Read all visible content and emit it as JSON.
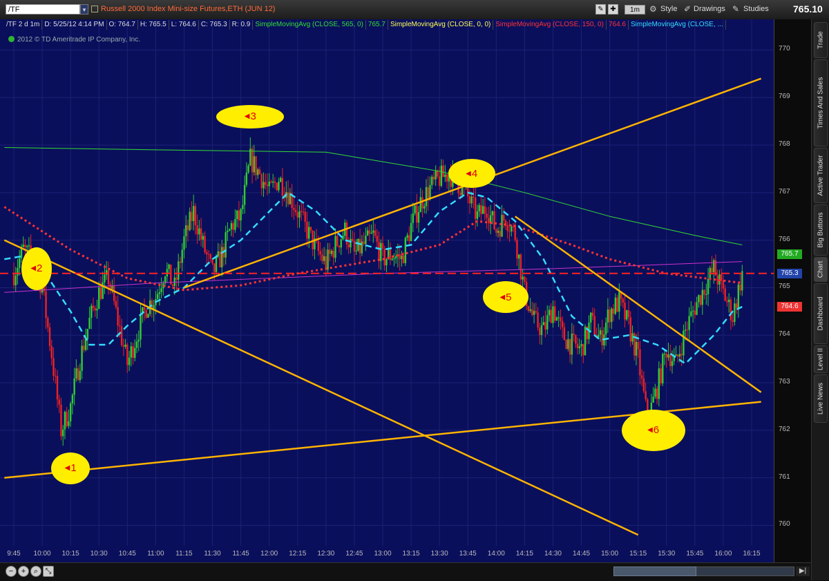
{
  "toolbar": {
    "symbol": "/TF",
    "instrument_title": "Russell 2000 Index Mini-size Futures,ETH (JUN 12)",
    "period": "1m",
    "style_label": "Style",
    "drawings_label": "Drawings",
    "studies_label": "Studies",
    "last_price": "765.10"
  },
  "study_bar": {
    "symbol_period": "/TF 2 d 1m",
    "datetime": "D: 5/25/12 4:14 PM",
    "open": "O: 764.7",
    "high": "H: 765.5",
    "low": "L: 764.6",
    "close": "C: 765.3",
    "range": "R: 0.9",
    "studies": [
      {
        "label": "SimpleMovingAvg (CLOSE, 565, 0)",
        "value": "765.7",
        "color": "#33dd33"
      },
      {
        "label": "SimpleMovingAvg (CLOSE, 0, 0)",
        "value": "",
        "color": "#ffff55"
      },
      {
        "label": "SimpleMovingAvg (CLOSE, 150, 0)",
        "value": "764.6",
        "color": "#ff3333"
      },
      {
        "label": "SimpleMovingAvg (CLOSE, ...",
        "value": "",
        "color": "#33ddff"
      }
    ]
  },
  "copyright": "2012 © TD Ameritrade IP Company, Inc.",
  "price_axis": {
    "ticks": [
      "770",
      "769",
      "768",
      "767",
      "766",
      "765",
      "764",
      "763",
      "762",
      "761",
      "760"
    ],
    "flags": [
      {
        "value": "765.7",
        "bg": "#22aa22",
        "fg": "#ffffff",
        "price": 765.7
      },
      {
        "value": "765.3",
        "bg": "#2244aa",
        "fg": "#ffffff",
        "price": 765.3
      },
      {
        "value": "764.6",
        "bg": "#ee3333",
        "fg": "#ffffff",
        "price": 764.6
      }
    ]
  },
  "time_axis": {
    "ticks": [
      "9:45",
      "10:00",
      "10:15",
      "10:30",
      "10:45",
      "11:00",
      "11:15",
      "11:30",
      "11:45",
      "12:00",
      "12:15",
      "12:30",
      "12:45",
      "13:00",
      "13:15",
      "13:30",
      "13:45",
      "14:00",
      "14:15",
      "14:30",
      "14:45",
      "15:00",
      "15:15",
      "15:30",
      "15:45",
      "16:00",
      "16:15"
    ]
  },
  "side_tabs": [
    "Trade",
    "Times And Sales",
    "Active Trader",
    "Big Buttons",
    "Chart",
    "Dashboard",
    "Level II",
    "Live News"
  ],
  "callouts": [
    "1",
    "2",
    "3",
    "4",
    "5",
    "6"
  ],
  "colors": {
    "background": "#0a0f5c",
    "bull_candle": "#33cc33",
    "bear_candle": "#ee2222",
    "trendline": "#ffb400",
    "sma565": "#33dd33",
    "sma150": "#ff3333",
    "sma_fast": "#33ddff",
    "sma_flat": "#cc33cc",
    "callout": "#ffee00"
  },
  "chart_data": {
    "type": "candlestick",
    "y_range": [
      759.6,
      770.5
    ],
    "x_range": [
      "9:40",
      "16:20"
    ],
    "price_path": [
      [
        "9:45",
        765.3
      ],
      [
        "9:50",
        765.8
      ],
      [
        "9:55",
        765.6
      ],
      [
        "10:00",
        765.0
      ],
      [
        "10:05",
        763.6
      ],
      [
        "10:10",
        762.0
      ],
      [
        "10:15",
        762.5
      ],
      [
        "10:20",
        763.5
      ],
      [
        "10:25",
        764.3
      ],
      [
        "10:30",
        764.9
      ],
      [
        "10:35",
        765.2
      ],
      [
        "10:40",
        764.3
      ],
      [
        "10:45",
        763.4
      ],
      [
        "10:50",
        764.0
      ],
      [
        "10:55",
        764.6
      ],
      [
        "11:00",
        764.8
      ],
      [
        "11:05",
        765.4
      ],
      [
        "11:10",
        765.0
      ],
      [
        "11:15",
        766.0
      ],
      [
        "11:20",
        766.6
      ],
      [
        "11:25",
        765.9
      ],
      [
        "11:30",
        765.3
      ],
      [
        "11:35",
        765.7
      ],
      [
        "11:40",
        766.3
      ],
      [
        "11:45",
        766.5
      ],
      [
        "11:50",
        767.7
      ],
      [
        "11:55",
        767.4
      ],
      [
        "12:00",
        767.0
      ],
      [
        "12:05",
        767.3
      ],
      [
        "12:10",
        767.0
      ],
      [
        "12:15",
        766.6
      ],
      [
        "12:20",
        766.2
      ],
      [
        "12:25",
        765.8
      ],
      [
        "12:30",
        765.5
      ],
      [
        "12:35",
        765.9
      ],
      [
        "12:40",
        766.2
      ],
      [
        "12:45",
        765.7
      ],
      [
        "12:50",
        765.9
      ],
      [
        "12:55",
        766.1
      ],
      [
        "13:00",
        765.6
      ],
      [
        "13:05",
        765.7
      ],
      [
        "13:10",
        765.6
      ],
      [
        "13:15",
        766.3
      ],
      [
        "13:20",
        766.8
      ],
      [
        "13:25",
        767.1
      ],
      [
        "13:30",
        767.3
      ],
      [
        "13:35",
        767.4
      ],
      [
        "13:40",
        767.2
      ],
      [
        "13:45",
        766.9
      ],
      [
        "13:50",
        766.5
      ],
      [
        "13:55",
        766.7
      ],
      [
        "14:00",
        766.2
      ],
      [
        "14:05",
        766.5
      ],
      [
        "14:10",
        766.1
      ],
      [
        "14:15",
        764.9
      ],
      [
        "14:20",
        764.3
      ],
      [
        "14:25",
        764.1
      ],
      [
        "14:30",
        764.6
      ],
      [
        "14:35",
        764.0
      ],
      [
        "14:40",
        763.8
      ],
      [
        "14:45",
        763.7
      ],
      [
        "14:50",
        764.3
      ],
      [
        "14:55",
        763.9
      ],
      [
        "15:00",
        764.5
      ],
      [
        "15:05",
        764.7
      ],
      [
        "15:10",
        764.2
      ],
      [
        "15:15",
        763.5
      ],
      [
        "15:20",
        762.2
      ],
      [
        "15:25",
        762.9
      ],
      [
        "15:30",
        763.7
      ],
      [
        "15:35",
        763.4
      ],
      [
        "15:40",
        764.1
      ],
      [
        "15:45",
        764.6
      ],
      [
        "15:50",
        765.0
      ],
      [
        "15:55",
        765.4
      ],
      [
        "16:00",
        764.9
      ],
      [
        "16:05",
        764.4
      ],
      [
        "16:10",
        765.3
      ]
    ],
    "sma565": [
      [
        "9:40",
        767.95
      ],
      [
        "11:00",
        767.9
      ],
      [
        "12:30",
        767.85
      ],
      [
        "13:30",
        767.45
      ],
      [
        "14:15",
        767.0
      ],
      [
        "15:00",
        766.5
      ],
      [
        "15:45",
        766.1
      ],
      [
        "16:10",
        765.9
      ]
    ],
    "sma150": [
      [
        "9:40",
        766.7
      ],
      [
        "10:15",
        765.8
      ],
      [
        "10:45",
        765.2
      ],
      [
        "11:15",
        764.95
      ],
      [
        "11:45",
        765.05
      ],
      [
        "12:15",
        765.3
      ],
      [
        "13:00",
        765.6
      ],
      [
        "13:30",
        765.9
      ],
      [
        "13:50",
        766.4
      ],
      [
        "14:10",
        766.3
      ],
      [
        "14:40",
        765.9
      ],
      [
        "15:00",
        765.6
      ],
      [
        "15:30",
        765.3
      ],
      [
        "16:10",
        765.1
      ]
    ],
    "sma_flat": [
      [
        "9:40",
        764.9
      ],
      [
        "11:00",
        765.1
      ],
      [
        "13:00",
        765.3
      ],
      [
        "14:30",
        765.4
      ],
      [
        "16:10",
        765.55
      ]
    ],
    "sma_fast": [
      [
        "9:40",
        765.6
      ],
      [
        "9:55",
        765.7
      ],
      [
        "10:05",
        765.1
      ],
      [
        "10:15",
        764.5
      ],
      [
        "10:25",
        763.8
      ],
      [
        "10:35",
        763.8
      ],
      [
        "10:45",
        764.2
      ],
      [
        "11:00",
        764.7
      ],
      [
        "11:15",
        765.0
      ],
      [
        "11:30",
        765.6
      ],
      [
        "11:45",
        766.0
      ],
      [
        "12:00",
        766.6
      ],
      [
        "12:10",
        767.0
      ],
      [
        "12:25",
        766.6
      ],
      [
        "12:40",
        766.0
      ],
      [
        "13:00",
        765.8
      ],
      [
        "13:15",
        765.9
      ],
      [
        "13:30",
        766.6
      ],
      [
        "13:45",
        767.0
      ],
      [
        "13:55",
        766.9
      ],
      [
        "14:10",
        766.4
      ],
      [
        "14:25",
        765.6
      ],
      [
        "14:40",
        764.4
      ],
      [
        "14:55",
        763.9
      ],
      [
        "15:10",
        764.0
      ],
      [
        "15:25",
        763.8
      ],
      [
        "15:40",
        763.4
      ],
      [
        "15:55",
        764.0
      ],
      [
        "16:05",
        764.5
      ],
      [
        "16:10",
        764.6
      ]
    ],
    "trendlines": [
      {
        "from": [
          "9:40",
          761.0
        ],
        "to": [
          "16:20",
          762.6
        ]
      },
      {
        "from": [
          "9:40",
          766.0
        ],
        "to": [
          "15:15",
          759.8
        ]
      },
      {
        "from": [
          "11:15",
          765.0
        ],
        "to": [
          "16:20",
          769.4
        ]
      },
      {
        "from": [
          "14:10",
          766.5
        ],
        "to": [
          "16:20",
          762.8
        ]
      }
    ],
    "hline": 765.3,
    "callout_points": [
      [
        "10:15",
        761.2
      ],
      [
        "9:57",
        765.4
      ],
      [
        "11:50",
        768.6
      ],
      [
        "13:47",
        767.4
      ],
      [
        "14:05",
        764.8
      ],
      [
        "15:23",
        762.0
      ]
    ]
  }
}
